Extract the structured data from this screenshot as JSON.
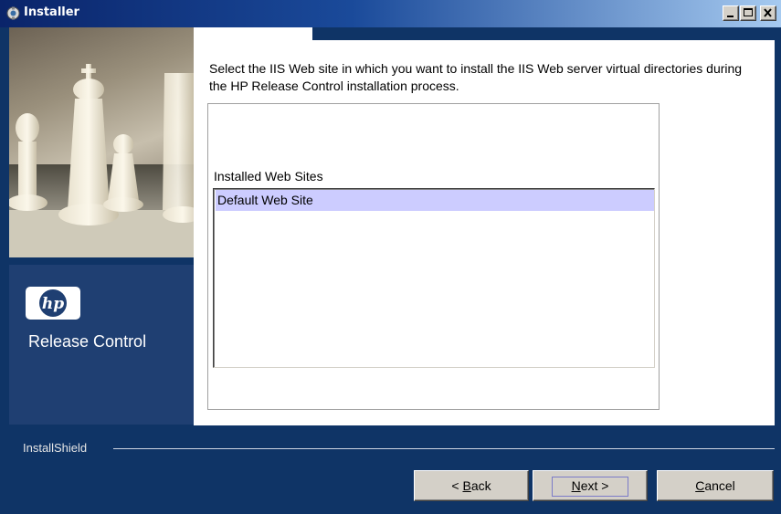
{
  "window": {
    "title": "Installer",
    "title_icon": "installer-app-icon",
    "controls": {
      "minimize_icon": "minimize-icon",
      "maximize_icon": "maximize-icon",
      "close_icon": "close-icon"
    }
  },
  "left_panel": {
    "image": "chess-pieces-banner",
    "logo_icon": "hp-logo",
    "logo_text": "hp",
    "product_name": "Release Control"
  },
  "main": {
    "instructions": "Select the IIS Web site in which you want to install the IIS Web server virtual directories during the HP Release Control installation process.",
    "list_label": "Installed Web Sites",
    "sites": [
      {
        "label": "Default Web Site",
        "selected": true
      }
    ]
  },
  "footer": {
    "brand": "InstallShield",
    "buttons": {
      "back": {
        "prefix": "< ",
        "mnemonic": "B",
        "rest": "ack"
      },
      "next": {
        "mnemonic": "N",
        "rest": "ext >"
      },
      "cancel": {
        "mnemonic": "C",
        "rest": "ancel"
      }
    }
  },
  "colors": {
    "window_background": "#0f3466",
    "brand_panel": "#1f3f72",
    "selection": "#ccccff",
    "button_face": "#d4d0c8"
  }
}
